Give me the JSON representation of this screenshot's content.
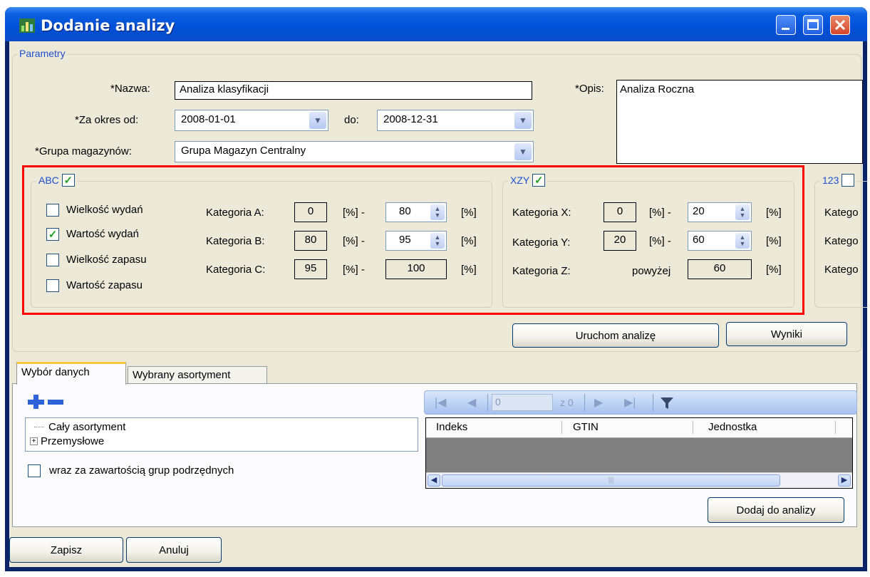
{
  "window": {
    "title": "Dodanie analizy"
  },
  "params": {
    "legend": "Parametry",
    "name_label": "*Nazwa:",
    "name_value": "Analiza klasyfikacji",
    "period_from_label": "*Za okres od:",
    "period_from": "2008-01-01",
    "period_to_label": "do:",
    "period_to": "2008-12-31",
    "group_label": "*Grupa magazynów:",
    "group_value": "Grupa Magazyn Centralny",
    "desc_label": "*Opis:",
    "desc_value": "Analiza Roczna"
  },
  "abc": {
    "legend": "ABC",
    "checked": true,
    "options": [
      {
        "label": "Wielkość wydań",
        "checked": false
      },
      {
        "label": "Wartość wydań",
        "checked": true
      },
      {
        "label": "Wielkość zapasu",
        "checked": false
      },
      {
        "label": "Wartość zapasu",
        "checked": false
      }
    ],
    "rows": [
      {
        "label": "Kategoria A:",
        "from": "0",
        "to": "80"
      },
      {
        "label": "Kategoria B:",
        "from": "80",
        "to": "95"
      },
      {
        "label": "Kategoria C:",
        "from": "95",
        "to": "100"
      }
    ],
    "pct": "[%]",
    "pct_dash": "[%] -"
  },
  "xzy": {
    "legend": "XZY",
    "checked": true,
    "rows": [
      {
        "label": "Kategoria X:",
        "from": "0",
        "to": "20"
      },
      {
        "label": "Kategoria Y:",
        "from": "20",
        "to": "60"
      }
    ],
    "z_label": "Kategoria Z:",
    "above_label": "powyżej",
    "z_value": "60",
    "pct": "[%]",
    "pct_dash": "[%] -"
  },
  "g123": {
    "legend": "123",
    "rows": [
      "Katego",
      "Katego",
      "Katego"
    ]
  },
  "buttons": {
    "run": "Uruchom analizę",
    "results": "Wyniki",
    "add": "Dodaj do analizy",
    "save": "Zapisz",
    "cancel": "Anuluj"
  },
  "tabs": [
    {
      "label": "Wybór danych"
    },
    {
      "label": "Wybrany asortyment"
    }
  ],
  "tree": {
    "items": [
      "Cały asortyment",
      "Przemysłowe"
    ]
  },
  "subgroups_label": "wraz za zawartością grup podrzędnych",
  "nav": {
    "position": "0",
    "of_label": "z 0"
  },
  "grid": {
    "columns": [
      "Indeks",
      "GTIN",
      "Jednostka"
    ]
  }
}
